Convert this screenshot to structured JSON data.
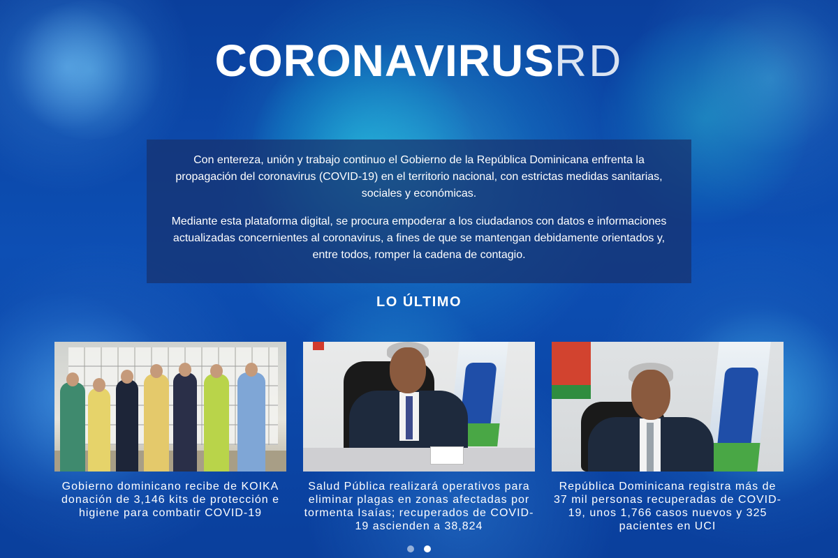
{
  "brand": {
    "title_main": "CORONAVIRUS",
    "title_suffix": "RD"
  },
  "intro": {
    "paragraph_1": "Con entereza, unión y trabajo continuo el Gobierno de la República Dominicana enfrenta la propagación del coronavirus (COVID-19) en el territorio nacional, con estrictas medidas sanitarias, sociales y económicas.",
    "paragraph_2": "Mediante esta plataforma digital, se procura empoderar a los ciudadanos con datos e informaciones actualizadas concernientes al coronavirus, a fines de que se mantengan debidamente orientados y, entre todos, romper la cadena de contagio."
  },
  "latest": {
    "heading": "LO ÚLTIMO",
    "items": [
      {
        "title": "Gobierno dominicano recibe de KOIKA donación de 3,146 kits de protección e higiene para combatir COVID-19",
        "image_alt": "Grupo de personas con mascarillas frente a cajas de donaciones"
      },
      {
        "title": "Salud Pública realizará operativos para eliminar plagas en zonas afectadas por tormenta Isaías; recuperados de COVID-19 ascienden a 38,824",
        "image_alt": "Ministro de Salud Pública en conferencia frente a bandera"
      },
      {
        "title": "República Dominicana registra más de 37 mil personas recuperadas de COVID-19, unos 1,766 casos nuevos y 325 pacientes en UCI",
        "image_alt": "Ministro de Salud Pública sentado frente a bandera"
      }
    ]
  },
  "carousel": {
    "page_count": 2,
    "active_page": 2
  },
  "colors": {
    "background": "#0d4fb4",
    "intro_box": "#18326e",
    "text": "#ffffff"
  }
}
